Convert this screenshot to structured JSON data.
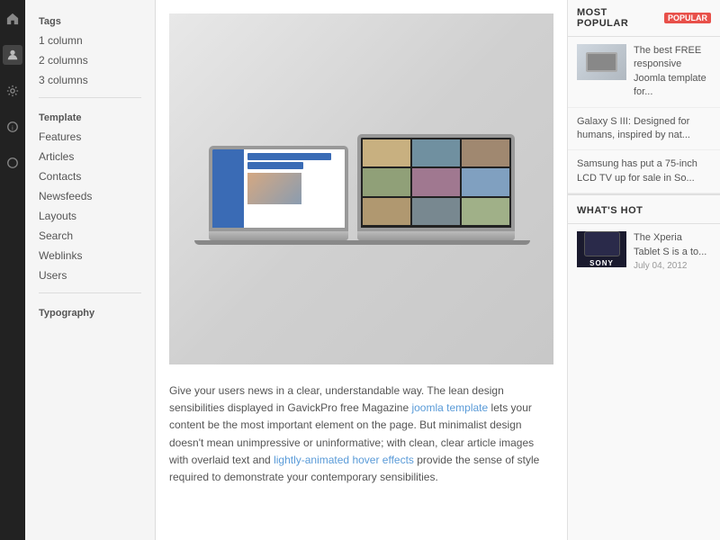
{
  "sidebar_icons": [
    {
      "name": "home-icon",
      "symbol": "⌂",
      "active": false
    },
    {
      "name": "user-icon",
      "symbol": "👤",
      "active": false
    },
    {
      "name": "settings-icon",
      "symbol": "⚙",
      "active": true
    },
    {
      "name": "info-icon",
      "symbol": "ℹ",
      "active": false
    },
    {
      "name": "circle-icon",
      "symbol": "○",
      "active": false
    }
  ],
  "nav": {
    "section1": {
      "title": "Tags",
      "items": [
        {
          "label": "1 column",
          "active": false
        },
        {
          "label": "2 columns",
          "active": false
        },
        {
          "label": "3 columns",
          "active": false
        }
      ]
    },
    "section2": {
      "title": "Template",
      "items": [
        {
          "label": "Features",
          "active": false
        },
        {
          "label": "Articles",
          "active": false
        },
        {
          "label": "Contacts",
          "active": false
        },
        {
          "label": "Newsfeeds",
          "active": false
        },
        {
          "label": "Layouts",
          "active": false
        },
        {
          "label": "Search",
          "active": false
        },
        {
          "label": "Weblinks",
          "active": false
        },
        {
          "label": "Users",
          "active": false
        }
      ]
    },
    "section3": {
      "title": "Typography",
      "items": []
    }
  },
  "main": {
    "body_text": "Give your users news in a clear, understandable way. The lean design sensibilities displayed in GavickPro free Magazine ",
    "link1": "joomla template",
    "body_text2": " lets your content be the most important element on the page. But minimalist design doesn't mean unimpressive or uninformative; with clean, clear article images with overlaid text and ",
    "link2": "lightly-animated hover effects",
    "body_text3": " provide the sense of style required to demonstrate your contemporary sensibilities."
  },
  "right_sidebar": {
    "most_popular": {
      "title": "MOST POPULAR",
      "badge": "POPULAR",
      "items": [
        {
          "text": "The best FREE responsive Joomla template for...",
          "has_thumb": true
        },
        {
          "text": "Galaxy S III: Designed for humans, inspired by nat...",
          "has_thumb": false
        },
        {
          "text": "Samsung has put a 75-inch LCD TV up for sale in So...",
          "has_thumb": false
        }
      ]
    },
    "whats_hot": {
      "title": "WHAT'S HOT",
      "items": [
        {
          "text": "The Xperia Tablet S is a to...",
          "date": "July 04, 2012",
          "brand": "SONY"
        }
      ]
    }
  }
}
